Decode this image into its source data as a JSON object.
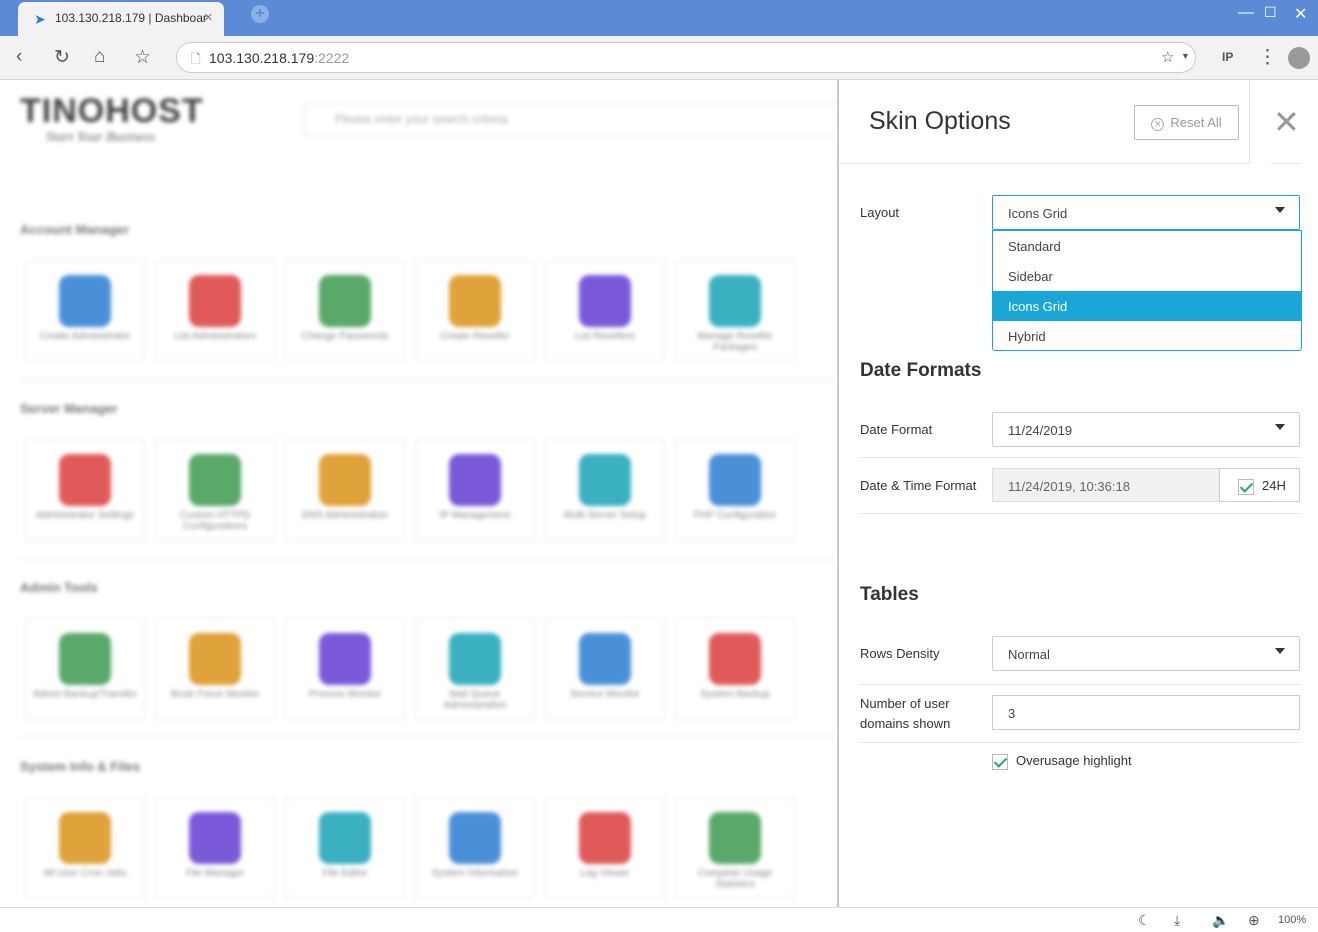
{
  "browser": {
    "tab_title": "103.130.218.179 | Dashboard",
    "url_host": "103.130.218.179",
    "url_port": ":2222",
    "zoom": "100%"
  },
  "background": {
    "logo": "TINOHOST",
    "slogan": "Start Your Business",
    "search_placeholder": "Please enter your search criteria",
    "sections": [
      {
        "title": "Account Manager",
        "items": [
          "Create Administrator",
          "List Administrators",
          "Change Passwords",
          "Create Reseller",
          "List Resellers",
          "Manage Reseller Packages"
        ]
      },
      {
        "title": "Server Manager",
        "items": [
          "Administrator Settings",
          "Custom HTTPD Configurations",
          "DNS Administration",
          "IP Management",
          "Multi Server Setup",
          "PHP Configuration"
        ]
      },
      {
        "title": "Admin Tools",
        "items": [
          "Admin Backup/Transfer",
          "Brute Force Monitor",
          "Process Monitor",
          "Mail Queue Administration",
          "Service Monitor",
          "System Backup"
        ]
      },
      {
        "title": "System Info & Files",
        "items": [
          "All User Cron Jobs",
          "File Manager",
          "File Editor",
          "System Information",
          "Log Viewer",
          "Complete Usage Statistics"
        ]
      }
    ]
  },
  "panel": {
    "title": "Skin Options",
    "reset_label": "Reset All",
    "layout_label": "Layout",
    "layout_value": "Icons Grid",
    "layout_options": [
      "Standard",
      "Sidebar",
      "Icons Grid",
      "Hybrid"
    ],
    "date_formats_heading": "Date Formats",
    "date_format_label": "Date Format",
    "date_format_value": "11/24/2019",
    "datetime_label": "Date & Time Format",
    "datetime_value": "11/24/2019, 10:36:18",
    "h24_label": "24H",
    "tables_heading": "Tables",
    "rows_density_label": "Rows Density",
    "rows_density_value": "Normal",
    "domains_label_1": "Number of user",
    "domains_label_2": "domains shown",
    "domains_value": "3",
    "overusage_label": "Overusage highlight"
  }
}
